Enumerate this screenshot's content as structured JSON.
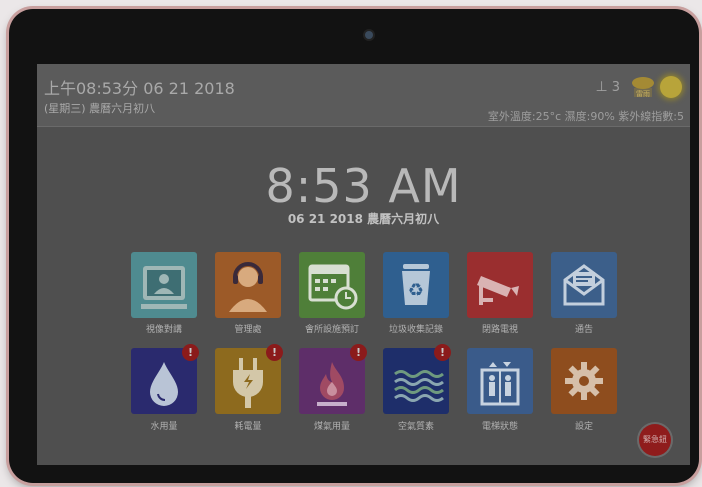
{
  "header": {
    "datetime": "上午08:53分  06 21 2018",
    "weekday_lunar": "(星期三)  農曆六月初八",
    "signal_level": "3",
    "weather_badge": "雷雨",
    "weather_stats": "室外溫度:25°c  濕度:90%  紫外線指數:5"
  },
  "clock": {
    "time": "8:53 AM",
    "date": "06 21 2018 農曆六月初八"
  },
  "tiles": [
    {
      "label": "視像對講",
      "icon": "video-intercom-icon",
      "color": "#4f8b90"
    },
    {
      "label": "管理處",
      "icon": "management-agent-icon",
      "color": "#9c5a28"
    },
    {
      "label": "會所設施預訂",
      "icon": "calendar-booking-icon",
      "color": "#4f7f39"
    },
    {
      "label": "垃圾收集記錄",
      "icon": "recycle-bin-icon",
      "color": "#2f5f8f"
    },
    {
      "label": "閉路電視",
      "icon": "cctv-camera-icon",
      "color": "#9a2e2f"
    },
    {
      "label": "通告",
      "icon": "envelope-icon",
      "color": "#3c5f8a"
    },
    {
      "label": "水用量",
      "icon": "water-drop-icon",
      "color": "#2a2a6e",
      "badge": "!"
    },
    {
      "label": "耗電量",
      "icon": "power-plug-icon",
      "color": "#8d6a1e",
      "badge": "!"
    },
    {
      "label": "煤氣用量",
      "icon": "gas-flame-icon",
      "color": "#5e2e69",
      "badge": "!"
    },
    {
      "label": "空氣質素",
      "icon": "air-wave-icon",
      "color": "#1e2e6a",
      "badge": "!"
    },
    {
      "label": "電梯狀態",
      "icon": "elevator-icon",
      "color": "#3a5b8a"
    },
    {
      "label": "設定",
      "icon": "gear-icon",
      "color": "#8e4d1e"
    }
  ],
  "emergency_label": "緊急鈕"
}
